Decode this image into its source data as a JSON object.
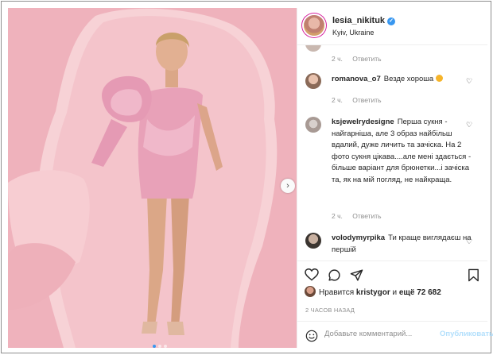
{
  "post": {
    "username": "lesia_nikituk",
    "location": "Kyiv, Ukraine",
    "carousel_dots": 3
  },
  "comments": [
    {
      "username": "",
      "text": "",
      "time": "2 ч.",
      "reply": "Ответить"
    },
    {
      "username": "romanova_o7",
      "text": "Везде хороша",
      "time": "2 ч.",
      "reply": "Ответить"
    },
    {
      "username": "ksjewelrydesigne",
      "text": "Перша сукня - найгарніша, але 3 образ найбільш вдалий, дуже личить та зачіска. На 2 фото сукня цікава....але мені здається - більше варіант для брюнетки...і зачіска та, як на мій погляд, не найкраща.",
      "time": "2 ч.",
      "reply": "Ответить"
    },
    {
      "username": "volodymyrpika",
      "text": "Ти краще виглядаєш на першій",
      "time": "",
      "reply": ""
    }
  ],
  "likes": {
    "prefix": "Нравится",
    "user": "kristygor",
    "middle": "и",
    "rest": "ещё 72 682"
  },
  "timestamp": "2 ЧАСОВ НАЗАД",
  "add_comment": {
    "placeholder": "Добавьте комментарий...",
    "publish_label": "Опубликовать"
  },
  "colors": {
    "photo_background": "#f0b3bd",
    "dress": "#e8a1b8",
    "verified": "#3897f0",
    "publish_disabled": "#b2dffc"
  }
}
